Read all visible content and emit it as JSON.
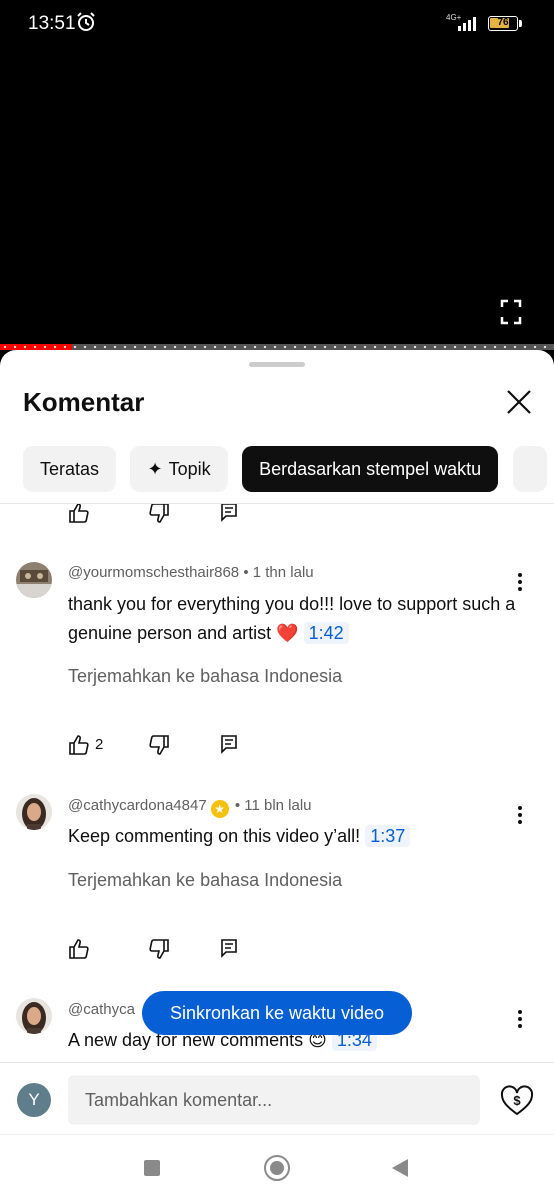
{
  "status_bar": {
    "time": "13:51",
    "network": "4G+",
    "battery": "76",
    "battery_level": 0.76,
    "icons": [
      "alarm-icon",
      "signal-icon",
      "battery-icon"
    ]
  },
  "video": {
    "progress_played": 0.13,
    "icons": [
      "fullscreen-icon"
    ]
  },
  "comments_panel": {
    "title": "Komentar",
    "close_icon": "close-icon",
    "chips": [
      {
        "label": "Teratas",
        "active": false
      },
      {
        "label": "Topik",
        "icon": "sparkle-icon",
        "active": false
      },
      {
        "label": "Berdasarkan stempel waktu",
        "active": true
      }
    ],
    "comments": [
      {
        "author": "@yourmomschesthair868",
        "time": "1 thn lalu",
        "text": "thank you for everything you do!!! love to support such a genuine person and artist ❤️",
        "timestamp": "1:42",
        "translate": "Terjemahkan ke bahasa Indonesia",
        "likes": "2"
      },
      {
        "author": "@cathycardona4847",
        "badge": "★",
        "time": "11 bln lalu",
        "text": "Keep commenting on this video y’all!",
        "timestamp": "1:37",
        "translate": "Terjemahkan ke bahasa Indonesia",
        "likes": ""
      },
      {
        "author": "@cathyca",
        "text": "A new day for new comments 😊",
        "timestamp": "1:34"
      }
    ],
    "sync_button": "Sinkronkan ke waktu video",
    "input": {
      "avatar_letter": "Y",
      "placeholder": "Tambahkan komentar..."
    },
    "icons": [
      "like-icon",
      "dislike-icon",
      "reply-icon",
      "more-vert-icon",
      "thanks-icon"
    ]
  },
  "colors": {
    "accent": "#065fd4",
    "progress": "#ff0000",
    "battery": "#e3b341"
  }
}
